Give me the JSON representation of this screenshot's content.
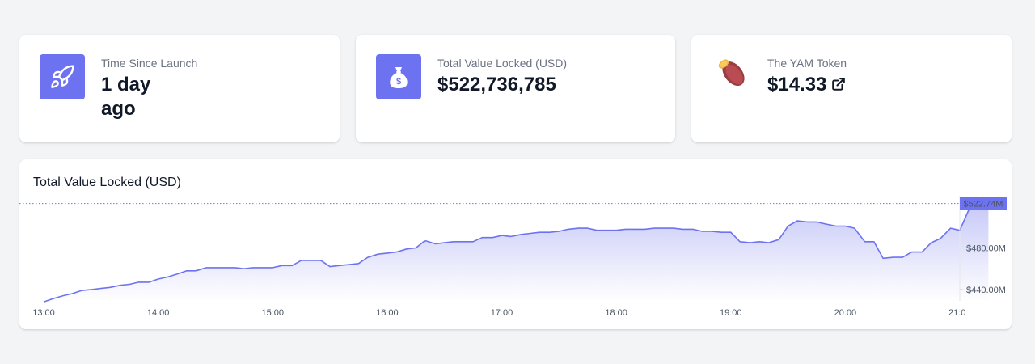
{
  "stats": {
    "launch": {
      "label": "Time Since Launch",
      "value_line1": "1 day",
      "value_line2": "ago"
    },
    "tvl": {
      "label": "Total Value Locked (USD)",
      "value": "$522,736,785"
    },
    "yam": {
      "label": "The YAM Token",
      "value": "$14.33"
    }
  },
  "icons": {
    "launch": "rocket-icon",
    "tvl": "money-bag-icon",
    "yam": "sweet-potato-icon",
    "link": "external-link-icon"
  },
  "colors": {
    "accent": "#6d72f0",
    "area_top": "#c7c8f7",
    "area_bottom": "#ffffff"
  },
  "chart_data": {
    "type": "area",
    "title": "Total Value Locked (USD)",
    "x_ticks": [
      "13:00",
      "14:00",
      "15:00",
      "16:00",
      "17:00",
      "18:00",
      "19:00",
      "20:00",
      "21:0"
    ],
    "y_ticks": [
      "$440.00M",
      "$480.00M"
    ],
    "y_tick_values": [
      440,
      480
    ],
    "current_label": "$522.74M",
    "current_value": 522.74,
    "x_range": [
      0,
      8
    ],
    "ylim": [
      429,
      524
    ],
    "grid": false,
    "points": [
      [
        0.0,
        428
      ],
      [
        0.08,
        431
      ],
      [
        0.17,
        434
      ],
      [
        0.25,
        436
      ],
      [
        0.33,
        439
      ],
      [
        0.42,
        440
      ],
      [
        0.5,
        441
      ],
      [
        0.58,
        442
      ],
      [
        0.67,
        444
      ],
      [
        0.75,
        445
      ],
      [
        0.83,
        447
      ],
      [
        0.92,
        447
      ],
      [
        1.0,
        450
      ],
      [
        1.08,
        452
      ],
      [
        1.17,
        455
      ],
      [
        1.25,
        458
      ],
      [
        1.33,
        458
      ],
      [
        1.42,
        461
      ],
      [
        1.5,
        461
      ],
      [
        1.58,
        461
      ],
      [
        1.67,
        461
      ],
      [
        1.75,
        460
      ],
      [
        1.83,
        461
      ],
      [
        1.92,
        461
      ],
      [
        2.0,
        461
      ],
      [
        2.08,
        463
      ],
      [
        2.17,
        463
      ],
      [
        2.25,
        468
      ],
      [
        2.33,
        468
      ],
      [
        2.42,
        468
      ],
      [
        2.5,
        462
      ],
      [
        2.58,
        463
      ],
      [
        2.67,
        464
      ],
      [
        2.75,
        465
      ],
      [
        2.83,
        471
      ],
      [
        2.92,
        474
      ],
      [
        3.0,
        475
      ],
      [
        3.08,
        476
      ],
      [
        3.17,
        479
      ],
      [
        3.25,
        480
      ],
      [
        3.33,
        487
      ],
      [
        3.42,
        484
      ],
      [
        3.5,
        485
      ],
      [
        3.58,
        486
      ],
      [
        3.67,
        486
      ],
      [
        3.75,
        486
      ],
      [
        3.83,
        490
      ],
      [
        3.92,
        490
      ],
      [
        4.0,
        492
      ],
      [
        4.08,
        491
      ],
      [
        4.17,
        493
      ],
      [
        4.25,
        494
      ],
      [
        4.33,
        495
      ],
      [
        4.42,
        495
      ],
      [
        4.5,
        496
      ],
      [
        4.58,
        498
      ],
      [
        4.67,
        499
      ],
      [
        4.75,
        499
      ],
      [
        4.83,
        497
      ],
      [
        4.92,
        497
      ],
      [
        5.0,
        497
      ],
      [
        5.08,
        498
      ],
      [
        5.17,
        498
      ],
      [
        5.25,
        498
      ],
      [
        5.33,
        499
      ],
      [
        5.42,
        499
      ],
      [
        5.5,
        499
      ],
      [
        5.58,
        498
      ],
      [
        5.67,
        498
      ],
      [
        5.75,
        496
      ],
      [
        5.83,
        496
      ],
      [
        5.92,
        495
      ],
      [
        6.0,
        495
      ],
      [
        6.08,
        486
      ],
      [
        6.17,
        485
      ],
      [
        6.25,
        486
      ],
      [
        6.33,
        485
      ],
      [
        6.42,
        488
      ],
      [
        6.5,
        501
      ],
      [
        6.58,
        506
      ],
      [
        6.67,
        505
      ],
      [
        6.75,
        505
      ],
      [
        6.83,
        503
      ],
      [
        6.92,
        501
      ],
      [
        7.0,
        501
      ],
      [
        7.08,
        499
      ],
      [
        7.17,
        486
      ],
      [
        7.25,
        486
      ],
      [
        7.33,
        470
      ],
      [
        7.42,
        471
      ],
      [
        7.5,
        471
      ],
      [
        7.58,
        476
      ],
      [
        7.67,
        476
      ],
      [
        7.75,
        485
      ],
      [
        7.83,
        489
      ],
      [
        7.92,
        499
      ],
      [
        8.0,
        497
      ],
      [
        8.08,
        517
      ],
      [
        8.17,
        521
      ],
      [
        8.25,
        522.74
      ]
    ]
  }
}
